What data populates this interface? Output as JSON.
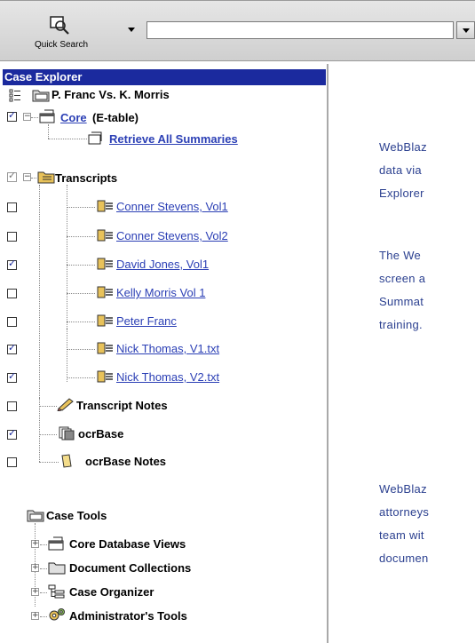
{
  "toolbar": {
    "quick_search_label": "Quick Search",
    "search_value": ""
  },
  "explorer": {
    "title": "Case Explorer",
    "case_name": "P. Franc Vs. K. Morris",
    "core_label": "Core",
    "core_suffix": "(E-table)",
    "retrieve_all": "Retrieve All Summaries",
    "transcripts_label": "Transcripts",
    "transcripts": [
      {
        "label": "Conner Stevens, Vol1",
        "checked": false
      },
      {
        "label": "Conner Stevens, Vol2",
        "checked": false
      },
      {
        "label": "David Jones, Vol1",
        "checked": true
      },
      {
        "label": "Kelly Morris Vol 1",
        "checked": false
      },
      {
        "label": "Peter Franc",
        "checked": false
      },
      {
        "label": "Nick Thomas, V1.txt",
        "checked": true
      },
      {
        "label": "Nick Thomas, V2.txt",
        "checked": true
      }
    ],
    "transcript_notes": "Transcript Notes",
    "ocrbase": "ocrBase",
    "ocrbase_notes": "ocrBase Notes",
    "case_tools": "Case Tools",
    "tools": [
      {
        "label": "Core Database Views",
        "icon": "table-view-icon"
      },
      {
        "label": "Document Collections",
        "icon": "folder-icon"
      },
      {
        "label": "Case Organizer",
        "icon": "tree-organizer-icon"
      },
      {
        "label": "Administrator's Tools",
        "icon": "gears-icon"
      }
    ]
  },
  "body_text": {
    "lines": [
      "WebBlaz",
      "data via",
      "Explorer",
      "The We",
      "screen a",
      "Summat",
      "training.",
      "WebBlaz",
      "attorneys",
      "team wit",
      "documen"
    ]
  }
}
